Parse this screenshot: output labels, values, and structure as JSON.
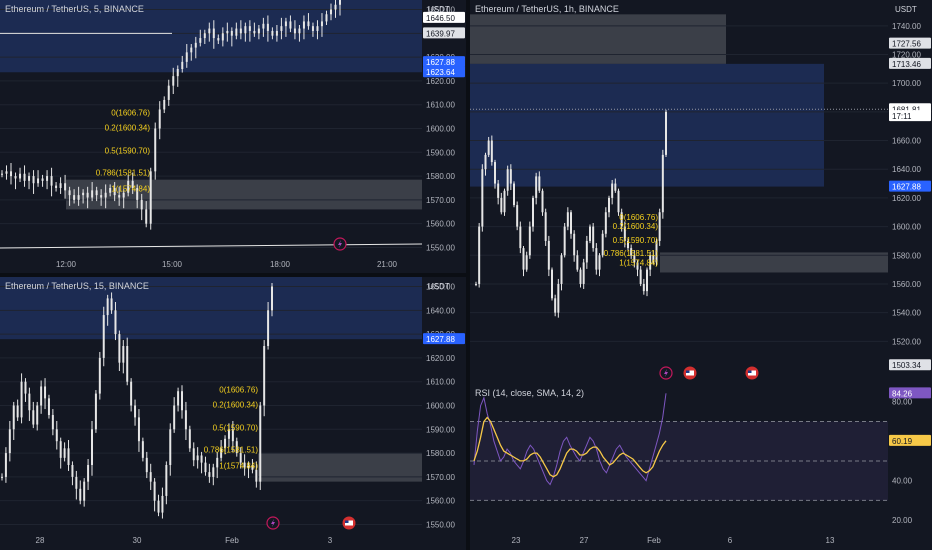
{
  "chart_data": [
    {
      "type": "candlestick",
      "title": "Ethereum / TetherUS, 5, BINANCE",
      "y_unit": "USDT",
      "y_ticks": [
        1550,
        1560,
        1570,
        1580,
        1590,
        1600,
        1610,
        1620,
        1630,
        1640,
        1650
      ],
      "ylim": [
        1546,
        1654
      ],
      "x_ticks": [
        "12:00",
        "15:00",
        "18:00",
        "21:00"
      ],
      "price_labels": [
        {
          "text": "1646.50",
          "value": 1646.5,
          "kind": "current"
        },
        {
          "text": "1639.97",
          "value": 1639.97,
          "kind": "level"
        },
        {
          "text": "1627.88",
          "value": 1627.88,
          "kind": "zone"
        },
        {
          "text": "1623.64",
          "value": 1623.64,
          "kind": "zone"
        }
      ],
      "fib_levels": [
        {
          "label": "0(1606.76)",
          "value": 1606.76
        },
        {
          "label": "0.2(1600.34)",
          "value": 1600.34
        },
        {
          "label": "0.5(1590.70)",
          "value": 1590.7
        },
        {
          "label": "0.786(1581.51)",
          "value": 1581.51
        },
        {
          "label": "1(1574.84)",
          "value": 1574.84
        }
      ],
      "zones": [
        {
          "from": 1623.64,
          "to": 1654,
          "color": "#1e2f5a"
        },
        {
          "from": 1566,
          "to": 1578.5,
          "color": "#4a4d55"
        }
      ],
      "series": [
        {
          "name": "",
          "values": [
            1581,
            1582,
            1580,
            1579,
            1581,
            1578,
            1580,
            1577,
            1579,
            1578,
            1580,
            1576,
            1575,
            1577,
            1574,
            1572,
            1570,
            1572,
            1573,
            1571,
            1574,
            1572,
            1571,
            1573,
            1575,
            1572,
            1571,
            1573,
            1578,
            1575,
            1570,
            1566,
            1560,
            1582,
            1600,
            1608,
            1612,
            1618,
            1622,
            1625,
            1628,
            1632,
            1634,
            1636,
            1638,
            1640,
            1642,
            1638,
            1637,
            1640,
            1641,
            1639,
            1642,
            1640,
            1643,
            1641,
            1640,
            1642,
            1644,
            1641,
            1639,
            1641,
            1643,
            1645,
            1642,
            1640,
            1642,
            1645,
            1643,
            1641,
            1643,
            1645,
            1648,
            1650,
            1652,
            1654
          ]
        }
      ]
    },
    {
      "type": "candlestick",
      "title": "Ethereum / TetherUS, 15, BINANCE",
      "y_unit": "USDT",
      "y_ticks": [
        1550,
        1560,
        1570,
        1580,
        1590,
        1600,
        1610,
        1620,
        1630,
        1640,
        1650
      ],
      "ylim": [
        1546,
        1654
      ],
      "x_ticks": [
        "28",
        "30",
        "Feb",
        "3"
      ],
      "price_labels": [
        {
          "text": "1627.88",
          "value": 1627.88,
          "kind": "zone"
        }
      ],
      "fib_levels": [
        {
          "label": "0(1606.76)",
          "value": 1606.76
        },
        {
          "label": "0.2(1600.34)",
          "value": 1600.34
        },
        {
          "label": "0.5(1590.70)",
          "value": 1590.7
        },
        {
          "label": "0.786(1581.51)",
          "value": 1581.51
        },
        {
          "label": "1(1574.84)",
          "value": 1574.84
        }
      ],
      "zones": [
        {
          "from": 1627.88,
          "to": 1654,
          "color": "#1e2f5a"
        },
        {
          "from": 1568,
          "to": 1580,
          "color": "#4a4d55"
        }
      ],
      "series": [
        {
          "name": "",
          "values": [
            1570,
            1580,
            1590,
            1600,
            1595,
            1610,
            1605,
            1598,
            1592,
            1600,
            1608,
            1603,
            1596,
            1590,
            1585,
            1578,
            1582,
            1575,
            1570,
            1565,
            1560,
            1568,
            1575,
            1590,
            1605,
            1620,
            1638,
            1645,
            1640,
            1630,
            1618,
            1625,
            1610,
            1600,
            1595,
            1585,
            1578,
            1572,
            1568,
            1560,
            1555,
            1562,
            1575,
            1590,
            1600,
            1606,
            1598,
            1590,
            1582,
            1577,
            1579,
            1576,
            1572,
            1570,
            1574,
            1578,
            1582,
            1586,
            1590,
            1585,
            1580,
            1576,
            1574,
            1575,
            1573,
            1568,
            1600,
            1625,
            1640,
            1650
          ]
        }
      ]
    },
    {
      "type": "candlestick",
      "title": "Ethereum / TetherUS, 1h, BINANCE",
      "y_unit": "USDT",
      "y_ticks": [
        1520,
        1540,
        1560,
        1580,
        1600,
        1620,
        1640,
        1660,
        1680,
        1700,
        1720,
        1740
      ],
      "ylim": [
        1500,
        1758
      ],
      "x_ticks": [
        "23",
        "27",
        "Feb",
        "6",
        "13"
      ],
      "price_labels": [
        {
          "text": "1727.56",
          "value": 1727.56,
          "kind": "level"
        },
        {
          "text": "1713.46",
          "value": 1713.46,
          "kind": "level"
        },
        {
          "text": "1681.81",
          "value": 1681.81,
          "kind": "current"
        },
        {
          "text": "17:11",
          "value": 1677.0,
          "kind": "countdown"
        },
        {
          "text": "1627.88",
          "value": 1627.88,
          "kind": "zone"
        },
        {
          "text": "1503.34",
          "value": 1503.34,
          "kind": "level"
        }
      ],
      "fib_levels": [
        {
          "label": "0(1606.76)",
          "value": 1606.76
        },
        {
          "label": "0.2(1600.34)",
          "value": 1600.34
        },
        {
          "label": "0.5(1590.70)",
          "value": 1590.7
        },
        {
          "label": "0.786(1581.51)",
          "value": 1581.51
        },
        {
          "label": "1(1574.84)",
          "value": 1574.84
        }
      ],
      "zones": [
        {
          "from": 1713.46,
          "to": 1748,
          "color": "#4a4d55"
        },
        {
          "from": 1627.88,
          "to": 1713.46,
          "color": "#1e2f5a"
        },
        {
          "from": 1568,
          "to": 1582,
          "color": "#4a4d55"
        }
      ],
      "series": [
        {
          "name": "",
          "values": [
            1560,
            1600,
            1640,
            1650,
            1660,
            1645,
            1630,
            1620,
            1610,
            1625,
            1640,
            1630,
            1615,
            1600,
            1585,
            1570,
            1580,
            1600,
            1620,
            1635,
            1625,
            1610,
            1590,
            1570,
            1550,
            1540,
            1560,
            1580,
            1600,
            1610,
            1595,
            1580,
            1570,
            1560,
            1575,
            1590,
            1600,
            1585,
            1570,
            1580,
            1595,
            1610,
            1620,
            1630,
            1625,
            1610,
            1600,
            1590,
            1585,
            1580,
            1575,
            1570,
            1560,
            1555,
            1570,
            1580,
            1575,
            1590,
            1610,
            1650,
            1680
          ]
        }
      ]
    },
    {
      "type": "line",
      "title": "RSI (14, close, SMA, 14, 2)",
      "y_ticks": [
        20,
        40,
        60,
        80
      ],
      "ylim": [
        14,
        90
      ],
      "bands": [
        30,
        50,
        70
      ],
      "price_labels": [
        {
          "text": "84.26",
          "value": 84.26,
          "kind": "rsi"
        },
        {
          "text": "60.19",
          "value": 60.19,
          "kind": "sma"
        }
      ],
      "series": [
        {
          "name": "",
          "values": [
            48,
            65,
            78,
            82,
            74,
            68,
            60,
            55,
            50,
            52,
            56,
            54,
            50,
            48,
            46,
            50,
            55,
            58,
            56,
            52,
            48,
            44,
            40,
            38,
            42,
            48,
            55,
            60,
            62,
            58,
            55,
            52,
            50,
            54,
            58,
            62,
            60,
            56,
            50,
            46,
            44,
            48,
            52,
            56,
            58,
            55,
            52,
            50,
            48,
            46,
            44,
            42,
            40,
            46,
            52,
            58,
            64,
            72,
            84.26
          ]
        },
        {
          "name": "",
          "values": [
            50,
            55,
            62,
            70,
            72,
            70,
            66,
            62,
            58,
            55,
            54,
            53,
            52,
            51,
            50,
            50,
            51,
            53,
            54,
            54,
            52,
            49,
            46,
            43,
            42,
            43,
            46,
            50,
            54,
            56,
            56,
            55,
            53,
            53,
            54,
            56,
            57,
            57,
            55,
            52,
            50,
            48,
            49,
            51,
            53,
            54,
            53,
            52,
            51,
            49,
            47,
            45,
            44,
            45,
            47,
            51,
            55,
            58,
            60.19
          ]
        }
      ]
    }
  ],
  "colors": {
    "bg": "#131722",
    "grid": "#1f2430",
    "axis_text": "#b2b5be",
    "candle": "#e6e6e6",
    "fib_text": "#f7d21e",
    "zone_blue": "#1e2f5a",
    "zone_gray": "#4a4d55",
    "tag_blue": "#2962ff",
    "rsi_line": "#7e57c2",
    "rsi_sma": "#f7c948"
  },
  "markers": [
    {
      "pane": 0,
      "icon": "lightning-icon"
    },
    {
      "pane": 1,
      "icon": "lightning-icon"
    },
    {
      "pane": 1,
      "icon": "us-flag-icon"
    },
    {
      "pane": 2,
      "icon": "lightning-icon"
    },
    {
      "pane": 2,
      "icon": "us-flag-icon"
    },
    {
      "pane": 2,
      "icon": "us-flag-icon"
    }
  ]
}
